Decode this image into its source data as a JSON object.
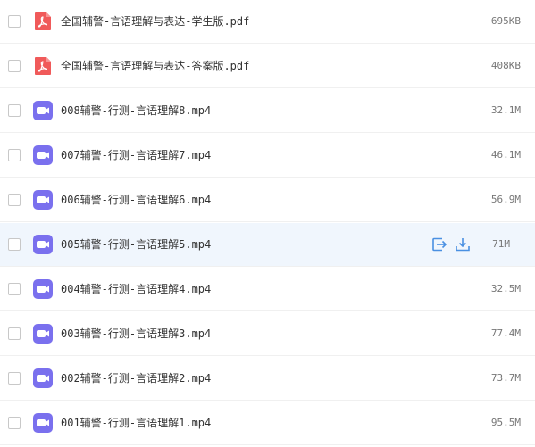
{
  "colors": {
    "pdf_icon": "#f05a5a",
    "video_icon": "#7a70ee",
    "action_icon": "#4a90e2",
    "hover_row": "#f0f6fd"
  },
  "files": [
    {
      "name": "全国辅警-言语理解与表达-学生版.pdf",
      "size": "695KB",
      "icon": "pdf-icon"
    },
    {
      "name": "全国辅警-言语理解与表达-答案版.pdf",
      "size": "408KB",
      "icon": "pdf-icon"
    },
    {
      "name": "008辅警-行测-言语理解8.mp4",
      "size": "32.1M",
      "icon": "video-icon"
    },
    {
      "name": "007辅警-行测-言语理解7.mp4",
      "size": "46.1M",
      "icon": "video-icon"
    },
    {
      "name": "006辅警-行测-言语理解6.mp4",
      "size": "56.9M",
      "icon": "video-icon"
    },
    {
      "name": "005辅警-行测-言语理解5.mp4",
      "size": "71M",
      "icon": "video-icon",
      "hovered": true
    },
    {
      "name": "004辅警-行测-言语理解4.mp4",
      "size": "32.5M",
      "icon": "video-icon"
    },
    {
      "name": "003辅警-行测-言语理解3.mp4",
      "size": "77.4M",
      "icon": "video-icon"
    },
    {
      "name": "002辅警-行测-言语理解2.mp4",
      "size": "73.7M",
      "icon": "video-icon"
    },
    {
      "name": "001辅警-行测-言语理解1.mp4",
      "size": "95.5M",
      "icon": "video-icon"
    }
  ]
}
